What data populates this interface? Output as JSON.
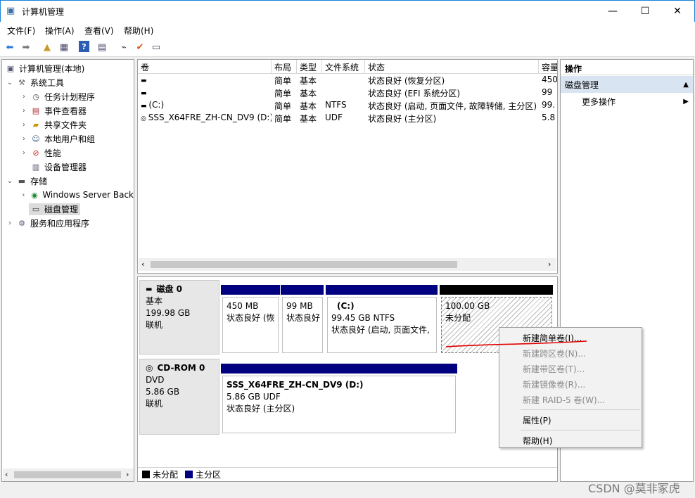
{
  "window": {
    "title": "计算机管理",
    "minimize": "—",
    "maximize": "☐",
    "close": "✕"
  },
  "menu": [
    "文件(F)",
    "操作(A)",
    "查看(V)",
    "帮助(H)"
  ],
  "tree": {
    "root": "计算机管理(本地)",
    "system_tools": "系统工具",
    "task_scheduler": "任务计划程序",
    "event_viewer": "事件查看器",
    "shared_folders": "共享文件夹",
    "local_users": "本地用户和组",
    "performance": "性能",
    "device_manager": "设备管理器",
    "storage": "存储",
    "windows_backup": "Windows Server Back",
    "disk_management": "磁盘管理",
    "services": "服务和应用程序"
  },
  "volumes": {
    "headers": [
      "卷",
      "布局",
      "类型",
      "文件系统",
      "状态",
      "容量"
    ],
    "rows": [
      {
        "name": "",
        "layout": "简单",
        "type": "基本",
        "fs": "",
        "status": "状态良好 (恢复分区)",
        "cap": "450"
      },
      {
        "name": "",
        "layout": "简单",
        "type": "基本",
        "fs": "",
        "status": "状态良好 (EFI 系统分区)",
        "cap": "99"
      },
      {
        "name": "(C:)",
        "layout": "简单",
        "type": "基本",
        "fs": "NTFS",
        "status": "状态良好 (启动, 页面文件, 故障转储, 主分区)",
        "cap": "99."
      },
      {
        "name": "SSS_X64FRE_ZH-CN_DV9 (D:)",
        "layout": "简单",
        "type": "基本",
        "fs": "UDF",
        "status": "状态良好 (主分区)",
        "cap": "5.8"
      }
    ]
  },
  "disk0": {
    "name": "磁盘 0",
    "kind": "基本",
    "size": "199.98 GB",
    "state": "联机",
    "parts": [
      {
        "title": "",
        "size": "450 MB",
        "status": "状态良好 (恢"
      },
      {
        "title": "",
        "size": "99 MB",
        "status": "状态良好"
      },
      {
        "title": "(C:)",
        "size": "99.45 GB NTFS",
        "status": "状态良好 (启动, 页面文件,"
      },
      {
        "title": "",
        "size": "100.00 GB",
        "status": "未分配"
      }
    ]
  },
  "cdrom0": {
    "name": "CD-ROM 0",
    "kind": "DVD",
    "size": "5.86 GB",
    "state": "联机",
    "part": {
      "title": "SSS_X64FRE_ZH-CN_DV9  (D:)",
      "size": "5.86 GB UDF",
      "status": "状态良好 (主分区)"
    }
  },
  "legend": {
    "unallocated": "未分配",
    "primary": "主分区"
  },
  "actions": {
    "header": "操作",
    "section": "磁盘管理",
    "more": "更多操作"
  },
  "context_menu": {
    "new_simple": "新建简单卷(I)...",
    "new_spanned": "新建跨区卷(N)...",
    "new_striped": "新建带区卷(T)...",
    "new_mirrored": "新建镜像卷(R)...",
    "new_raid5": "新建 RAID-5 卷(W)...",
    "properties": "属性(P)",
    "help": "帮助(H)"
  },
  "watermark": "CSDN @莫非冢虎",
  "colors": {
    "primary": "#000080",
    "unallocated": "#000000",
    "annotation": "#e00000",
    "accent": "#1883d7"
  }
}
